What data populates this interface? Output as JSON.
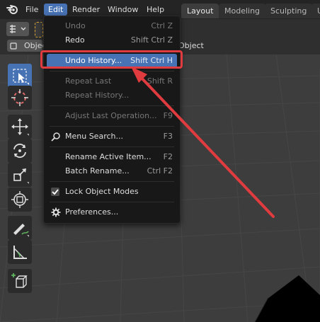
{
  "menubar": {
    "items": [
      "File",
      "Edit",
      "Render",
      "Window",
      "Help"
    ],
    "active": "Edit"
  },
  "workspace_tabs": [
    "Layout",
    "Modeling",
    "Sculpting",
    "U"
  ],
  "header": {
    "mode_left": "Object",
    "mode_right": "Object"
  },
  "edit_menu": {
    "items": [
      {
        "label": "Undo",
        "shortcut": "Ctrl Z",
        "disabled": true
      },
      {
        "label": "Redo",
        "shortcut": "Shift Ctrl Z",
        "disabled": false
      },
      {
        "label": "Undo History...",
        "shortcut": "Shift Ctrl H",
        "highlighted": true
      },
      {
        "label": "Repeat Last",
        "shortcut": "Shift R",
        "disabled": true
      },
      {
        "label": "Repeat History...",
        "shortcut": "",
        "disabled": true
      },
      {
        "label": "Adjust Last Operation...",
        "shortcut": "F9",
        "disabled": true
      },
      {
        "label": "Menu Search...",
        "shortcut": "F3",
        "icon": "search-icon"
      },
      {
        "label": "Rename Active Item...",
        "shortcut": "F2"
      },
      {
        "label": "Batch Rename...",
        "shortcut": "Ctrl F2"
      },
      {
        "label": "Lock Object Modes",
        "shortcut": "",
        "checked": true
      },
      {
        "label": "Preferences...",
        "shortcut": "",
        "icon": "gear-icon"
      }
    ]
  },
  "colors": {
    "accent": "#4772b3",
    "annotation": "#e03b3e"
  }
}
